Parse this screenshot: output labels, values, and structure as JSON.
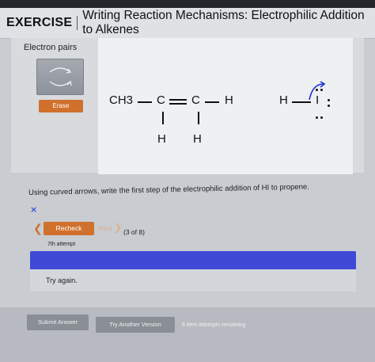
{
  "header": {
    "exercise": "EXERCISE",
    "title": "Writing Reaction Mechanisms: Electrophilic Addition to Alkenes"
  },
  "tools": {
    "electron_pairs_label": "Electron pairs",
    "erase_label": "Erase"
  },
  "molecule": {
    "ch3": "CH3",
    "c1": "C",
    "c2": "C",
    "h_right": "H",
    "h_below_1": "H",
    "h_below_2": "H",
    "hi_h": "H",
    "hi_i": "I"
  },
  "question": {
    "text": "Using curved arrows, write the first step of the electrophilic addition of HI to propene.",
    "status_mark": "×"
  },
  "nav": {
    "recheck_label": "Recheck",
    "next_label": "Next",
    "count": "(3 of 8)",
    "attempt": "7th attempt"
  },
  "feedback": {
    "text": "Try again."
  },
  "footer": {
    "submit_label": "Submit Answer",
    "try_another_label": "Try Another Version",
    "remaining_text": "6 item attempts remaining"
  },
  "colors": {
    "accent_orange": "#d0702d",
    "feedback_blue": "#3f49d6"
  }
}
